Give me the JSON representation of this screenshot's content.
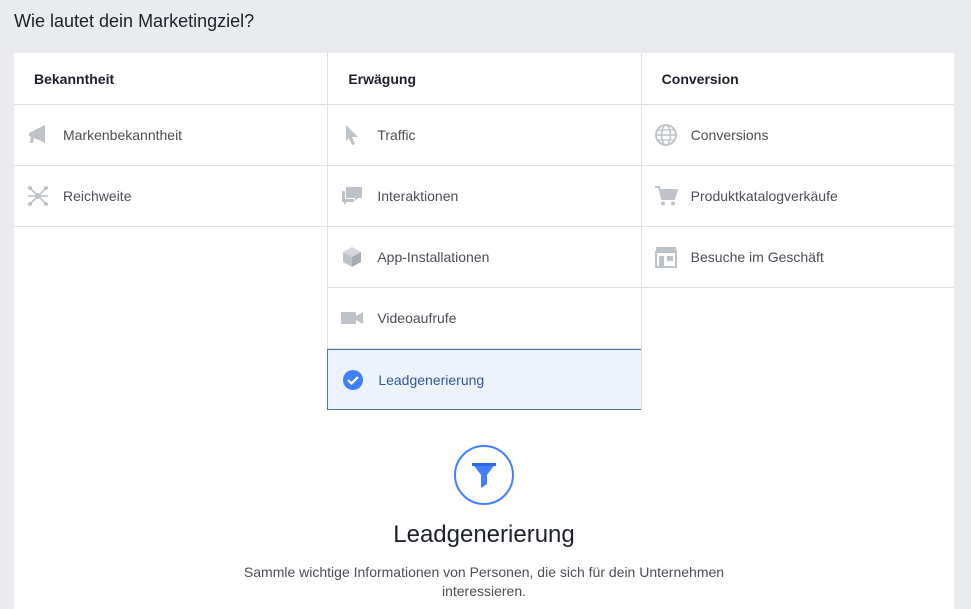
{
  "heading": "Wie lautet dein Marketingziel?",
  "columns": [
    {
      "header": "Bekanntheit",
      "items": [
        {
          "label": "Markenbekanntheit",
          "icon": "megaphone-icon"
        },
        {
          "label": "Reichweite",
          "icon": "reach-icon"
        }
      ]
    },
    {
      "header": "Erwägung",
      "items": [
        {
          "label": "Traffic",
          "icon": "cursor-icon"
        },
        {
          "label": "Interaktionen",
          "icon": "chat-bubbles-icon"
        },
        {
          "label": "App-Installationen",
          "icon": "cube-icon"
        },
        {
          "label": "Videoaufrufe",
          "icon": "video-camera-icon"
        },
        {
          "label": "Leadgenerierung",
          "icon": "check-circle-icon",
          "selected": true
        }
      ]
    },
    {
      "header": "Conversion",
      "items": [
        {
          "label": "Conversions",
          "icon": "globe-icon"
        },
        {
          "label": "Produktkatalogverkäufe",
          "icon": "shopping-cart-icon"
        },
        {
          "label": "Besuche im Geschäft",
          "icon": "storefront-icon"
        }
      ]
    }
  ],
  "detail": {
    "icon": "funnel-icon",
    "title": "Leadgenerierung",
    "description": "Sammle wichtige Informationen von Personen, die sich für dein Unternehmen interessieren."
  },
  "colors": {
    "accent": "#4080ff",
    "selected_bg": "#ecf3fd",
    "selected_border": "#4a76a8",
    "icon_gray": "#bec3c9"
  }
}
